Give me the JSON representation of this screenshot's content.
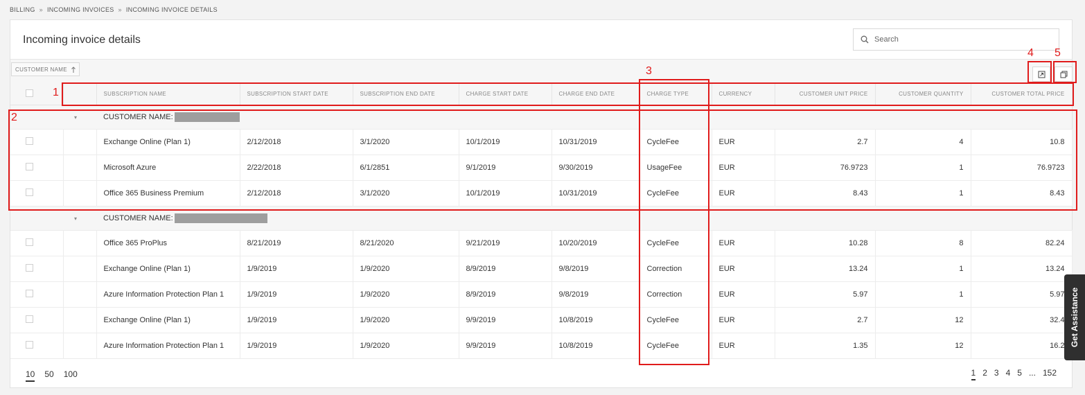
{
  "breadcrumb": [
    "BILLING",
    "INCOMING INVOICES",
    "INCOMING INVOICE DETAILS"
  ],
  "breadcrumb_sep": "»",
  "page_title": "Incoming invoice details",
  "search": {
    "placeholder": "Search"
  },
  "group_chip": {
    "label": "CUSTOMER NAME",
    "sort_icon": "arrow-up"
  },
  "columns": [
    "SUBSCRIPTION NAME",
    "SUBSCRIPTION START DATE",
    "SUBSCRIPTION END DATE",
    "CHARGE START DATE",
    "CHARGE END DATE",
    "CHARGE TYPE",
    "CURRENCY",
    "CUSTOMER UNIT PRICE",
    "CUSTOMER QUANTITY",
    "CUSTOMER TOTAL PRICE"
  ],
  "groups": [
    {
      "label": "CUSTOMER NAME:",
      "rows": [
        [
          "Exchange Online (Plan 1)",
          "2/12/2018",
          "3/1/2020",
          "10/1/2019",
          "10/31/2019",
          "CycleFee",
          "EUR",
          "2.7",
          "4",
          "10.8"
        ],
        [
          "Microsoft Azure",
          "2/22/2018",
          "6/1/2851",
          "9/1/2019",
          "9/30/2019",
          "UsageFee",
          "EUR",
          "76.9723",
          "1",
          "76.9723"
        ],
        [
          "Office 365 Business Premium",
          "2/12/2018",
          "3/1/2020",
          "10/1/2019",
          "10/31/2019",
          "CycleFee",
          "EUR",
          "8.43",
          "1",
          "8.43"
        ]
      ]
    },
    {
      "label": "CUSTOMER NAME:",
      "rows": [
        [
          "Office 365 ProPlus",
          "8/21/2019",
          "8/21/2020",
          "9/21/2019",
          "10/20/2019",
          "CycleFee",
          "EUR",
          "10.28",
          "8",
          "82.24"
        ],
        [
          "Exchange Online (Plan 1)",
          "1/9/2019",
          "1/9/2020",
          "8/9/2019",
          "9/8/2019",
          "Correction",
          "EUR",
          "13.24",
          "1",
          "13.24"
        ],
        [
          "Azure Information Protection Plan 1",
          "1/9/2019",
          "1/9/2020",
          "8/9/2019",
          "9/8/2019",
          "Correction",
          "EUR",
          "5.97",
          "1",
          "5.97"
        ],
        [
          "Exchange Online (Plan 1)",
          "1/9/2019",
          "1/9/2020",
          "9/9/2019",
          "10/8/2019",
          "CycleFee",
          "EUR",
          "2.7",
          "12",
          "32.4"
        ],
        [
          "Azure Information Protection Plan 1",
          "1/9/2019",
          "1/9/2020",
          "9/9/2019",
          "10/8/2019",
          "CycleFee",
          "EUR",
          "1.35",
          "12",
          "16.2"
        ]
      ]
    }
  ],
  "page_sizes": [
    "10",
    "50",
    "100"
  ],
  "active_page_size": "10",
  "pages": [
    "1",
    "2",
    "3",
    "4",
    "5",
    "...",
    "152"
  ],
  "active_page": "1",
  "annotations": [
    "1",
    "2",
    "3",
    "4",
    "5"
  ],
  "assist_label": "Get Assistance",
  "colors": {
    "annotation": "#e01b1b",
    "header_bg": "#f6f6f6",
    "assist_bg": "#2f2f2f"
  }
}
